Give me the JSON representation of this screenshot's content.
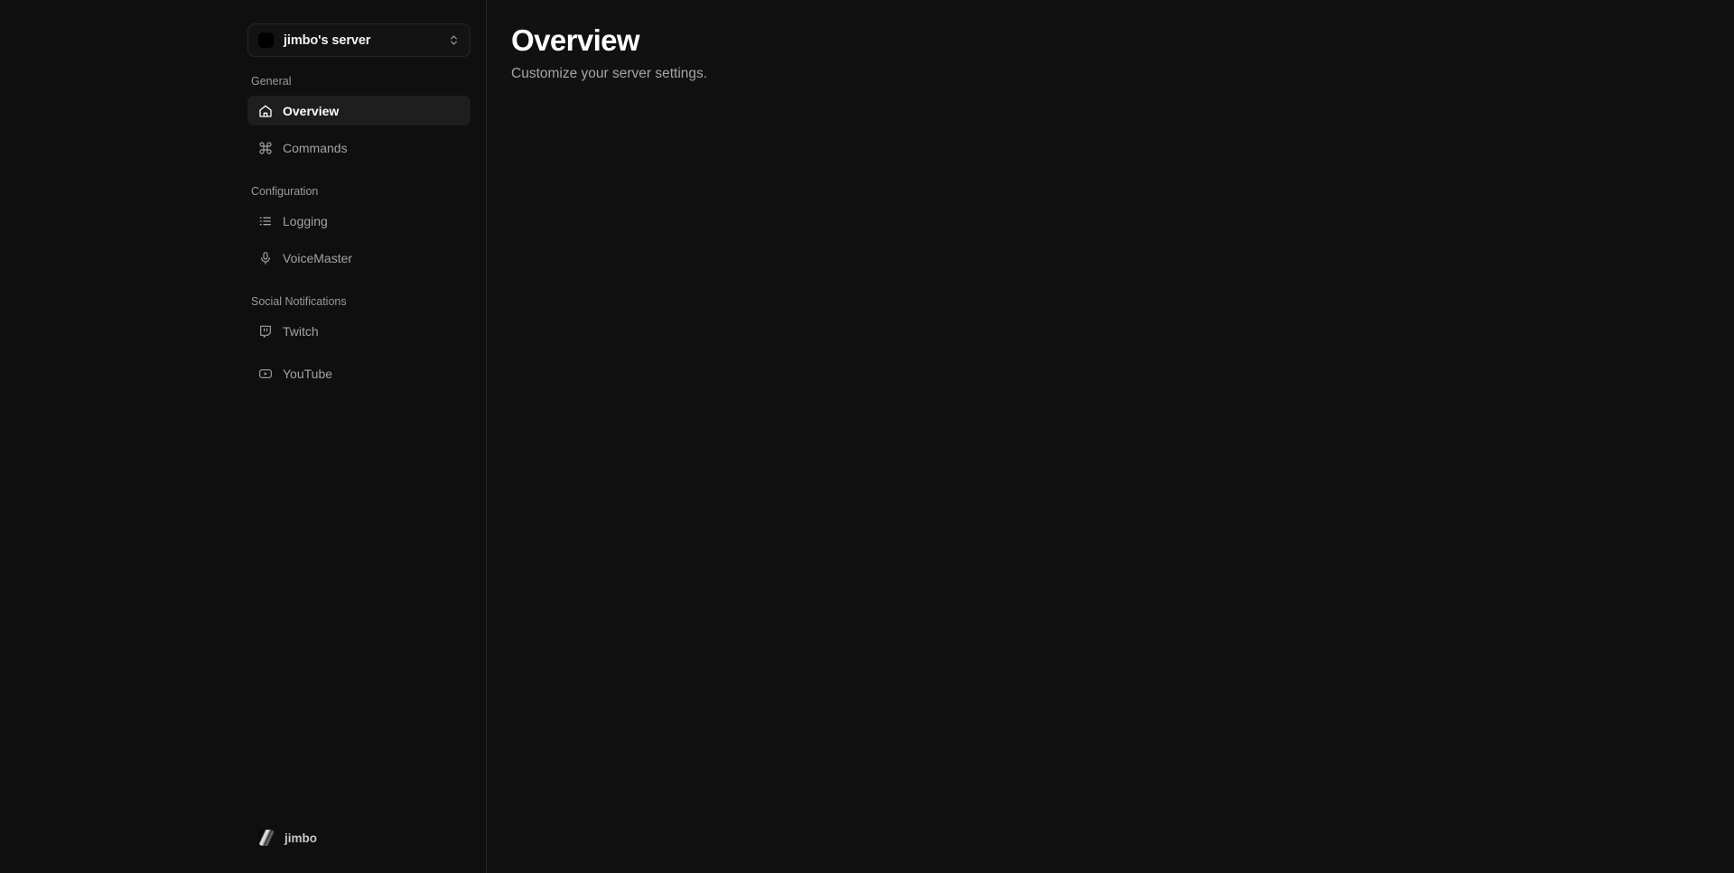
{
  "server_selector": {
    "name": "jimbo's server",
    "avatar_color": "#000000",
    "chevron_icon": "chevron-up-down-icon"
  },
  "sidebar": {
    "sections": [
      {
        "label": "General",
        "items": [
          {
            "label": "Overview",
            "icon": "home-icon",
            "active": true
          },
          {
            "label": "Commands",
            "icon": "command-icon",
            "active": false
          }
        ]
      },
      {
        "label": "Configuration",
        "items": [
          {
            "label": "Logging",
            "icon": "list-icon",
            "active": false
          },
          {
            "label": "VoiceMaster",
            "icon": "microphone-icon",
            "active": false
          }
        ]
      },
      {
        "label": "Social Notifications",
        "items": [
          {
            "label": "Twitch",
            "icon": "twitch-icon",
            "active": false
          },
          {
            "label": "YouTube",
            "icon": "youtube-icon",
            "active": false
          }
        ]
      }
    ],
    "user": {
      "name": "jimbo",
      "avatar": "user-avatar-image"
    }
  },
  "main": {
    "title": "Overview",
    "subtitle": "Customize your server settings."
  },
  "colors": {
    "background": "#111111",
    "sidebar_background": "#0f0f0f",
    "active_item_background": "#1e1e1e",
    "border": "#242424",
    "text_primary": "#ffffff",
    "text_muted": "#a3a3a3"
  }
}
